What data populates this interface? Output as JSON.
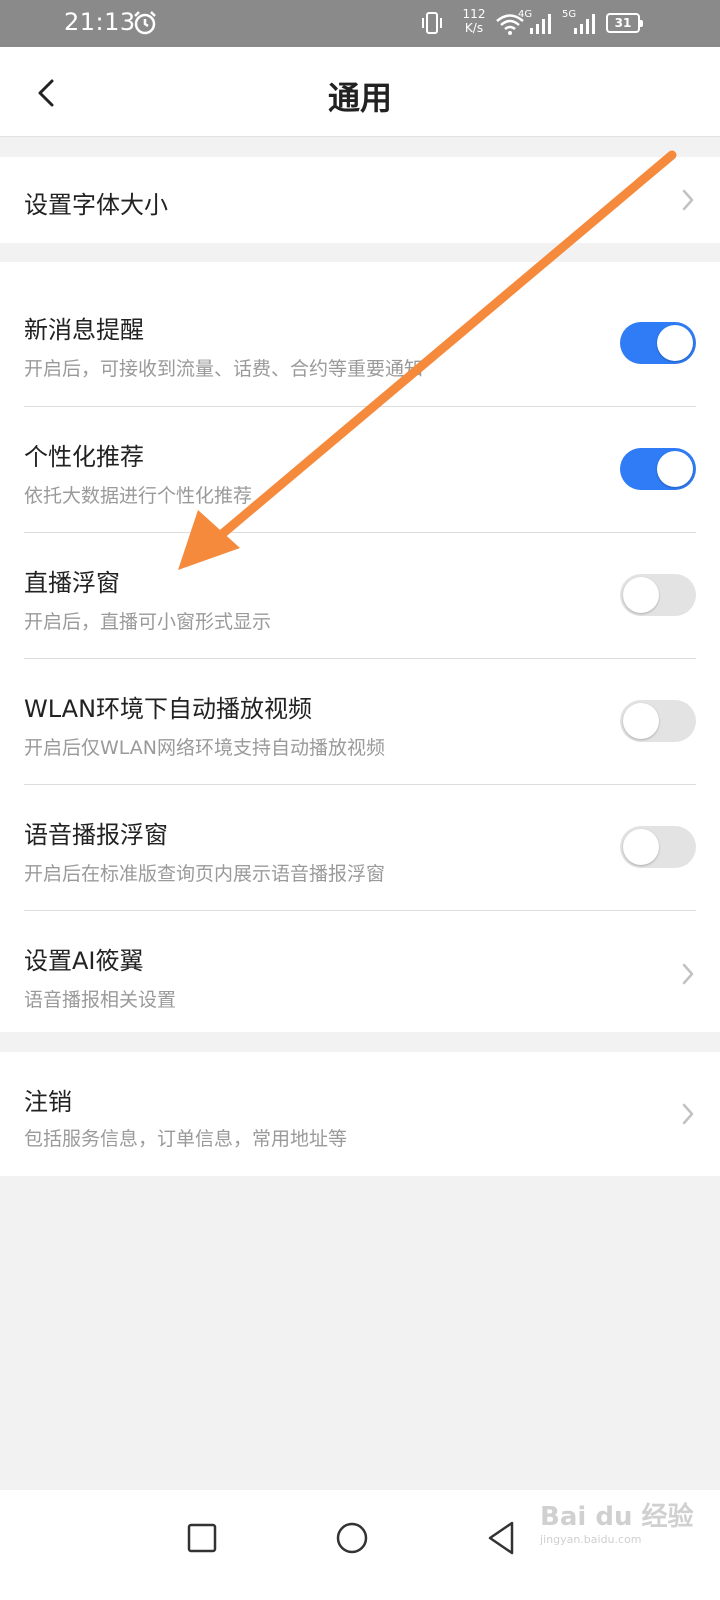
{
  "status_bar": {
    "time": "21:13",
    "speed_value": "112",
    "speed_unit": "K/s",
    "net_label_1": "4G",
    "net_label_2": "5G",
    "battery": "31"
  },
  "header": {
    "title": "通用",
    "back_icon": "chevron-left-icon"
  },
  "font_size_row": {
    "title": "设置字体大小"
  },
  "settings": [
    {
      "title": "新消息提醒",
      "subtitle": "开启后，可接收到流量、话费、合约等重要通知",
      "control": "toggle",
      "enabled": true
    },
    {
      "title": "个性化推荐",
      "subtitle": "依托大数据进行个性化推荐",
      "control": "toggle",
      "enabled": true
    },
    {
      "title": "直播浮窗",
      "subtitle": "开启后，直播可小窗形式显示",
      "control": "toggle",
      "enabled": false
    },
    {
      "title": "WLAN环境下自动播放视频",
      "subtitle": "开启后仅WLAN网络环境支持自动播放视频",
      "control": "toggle",
      "enabled": false
    },
    {
      "title": "语音播报浮窗",
      "subtitle": "开启后在标准版查询页内展示语音播报浮窗",
      "control": "toggle",
      "enabled": false
    },
    {
      "title": "设置AI筱翼",
      "subtitle": "语音播报相关设置",
      "control": "chevron"
    }
  ],
  "logout_row": {
    "title": "注销",
    "subtitle": "包括服务信息，订单信息，常用地址等"
  },
  "colors": {
    "toggle_on": "#2f7cf6",
    "toggle_off": "#e3e3e3",
    "annotation_arrow": "#f58a3c"
  },
  "watermark": {
    "text": "Bai du 经验",
    "sub": "jingyan.baidu.com"
  }
}
